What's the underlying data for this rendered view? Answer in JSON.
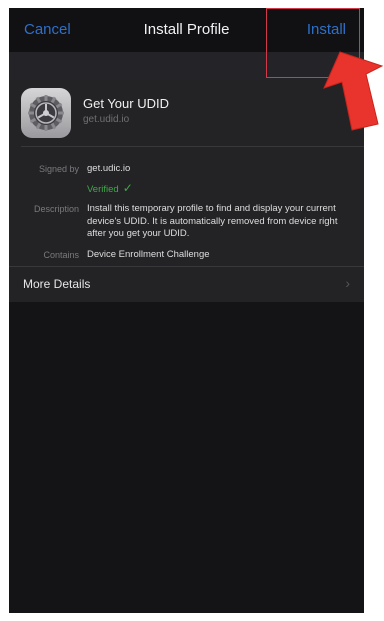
{
  "navbar": {
    "cancel_label": "Cancel",
    "title": "Install Profile",
    "install_label": "Install"
  },
  "profile": {
    "name": "Get Your UDID",
    "host": "get.udid.io",
    "icon": "settings-gear-icon"
  },
  "details": {
    "signed_by_label": "Signed by",
    "signed_by_value": "get.udic.io",
    "verified_label": "Verified",
    "verified_icon": "checkmark-icon",
    "description_label": "Description",
    "description_value": "Install this temporary profile to find and display your current device's UDID. It is automatically removed from device right after you get your UDID.",
    "contains_label": "Contains",
    "contains_value": "Device Enrollment Challenge"
  },
  "more_details": {
    "label": "More Details",
    "icon": "chevron-right-icon"
  },
  "colors": {
    "accent": "#2f6fc8",
    "verified": "#3fa848",
    "annotation": "#d23a4a",
    "background": "#141416",
    "card": "#232326"
  }
}
